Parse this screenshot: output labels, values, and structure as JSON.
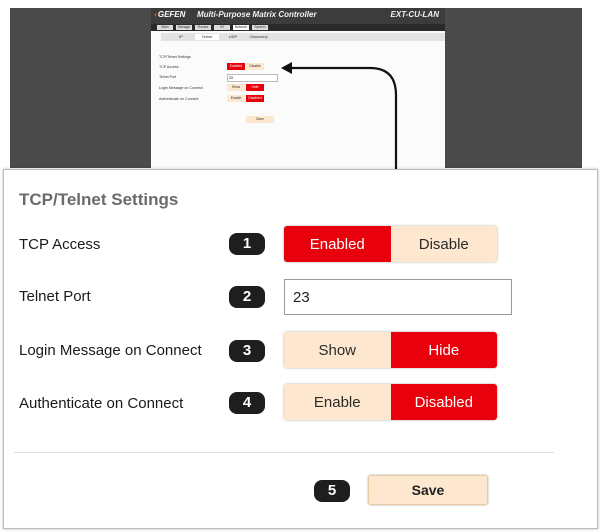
{
  "thumbnail": {
    "brand": "GEFEN",
    "window_title": "Multi-Purpose Matrix Controller",
    "model": "EXT-CU-LAN",
    "nav_tabs": [
      "Main",
      "Manage",
      "Routes",
      "I/O",
      "Network",
      "System"
    ],
    "nav_active": "Network",
    "sub_tabs": [
      "IP",
      "Telnet",
      "UDP",
      "Discovery"
    ],
    "sub_active": "Telnet"
  },
  "panel": {
    "title": "TCP/Telnet Settings",
    "rows": [
      {
        "label": "TCP Access",
        "marker": "1",
        "options": [
          "Enabled",
          "Disable"
        ],
        "selected": "Enabled"
      },
      {
        "label": "Telnet Port",
        "marker": "2",
        "value": "23"
      },
      {
        "label": "Login Message on Connect",
        "marker": "3",
        "options": [
          "Show",
          "Hide"
        ],
        "selected": "Hide"
      },
      {
        "label": "Authenticate on Connect",
        "marker": "4",
        "options": [
          "Enable",
          "Disabled"
        ],
        "selected": "Disabled"
      }
    ],
    "save": {
      "marker": "5",
      "label": "Save"
    }
  },
  "colors": {
    "selected": "#e8000c",
    "unselected": "#fde8cf",
    "marker": "#1e1e1e",
    "title": "#6b6b6b"
  }
}
